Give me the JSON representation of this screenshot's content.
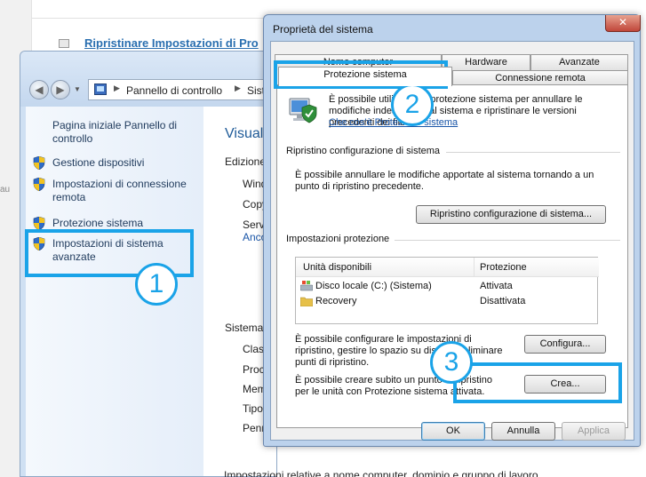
{
  "background_page": {
    "heading_link": "Ripristinare Impostazioni di Pro",
    "left_strip_text": "au"
  },
  "control_panel": {
    "address": {
      "crumb1": "Pannello di controllo",
      "crumb2": "Siste"
    },
    "sidebar": {
      "home": "Pagina iniziale Pannello di controllo",
      "items": [
        {
          "label": "Gestione dispositivi",
          "icon": "uac-shield-icon"
        },
        {
          "label": "Impostazioni di connessione remota",
          "icon": "uac-shield-icon"
        },
        {
          "label": "Protezione sistema",
          "icon": "uac-shield-icon"
        },
        {
          "label": "Impostazioni di sistema avanzate",
          "icon": "uac-shield-icon"
        }
      ]
    },
    "main": {
      "title": "Visuali",
      "edition_label": "Edizione",
      "edition_rows": [
        "Wind",
        "Copy",
        "Servi"
      ],
      "edition_link": "Anco",
      "system_label": "Sistema",
      "system_rows": [
        "Class",
        "Proc",
        "Mem",
        "Tipo",
        "Penn"
      ],
      "footer": "Impostazioni relative a nome computer, dominio e gruppo di lavoro"
    }
  },
  "dialog": {
    "title": "Proprietà del sistema",
    "close_label": "✕",
    "tabs": {
      "computer_name": "Nome computer",
      "hardware": "Hardware",
      "advanced": "Avanzate",
      "system_protection": "Protezione sistema",
      "remote": "Connessione remota"
    },
    "intro_text": "È possibile utilizzare la protezione sistema per annullare le modifiche indesiderate al sistema e ripristinare le versioni precedenti dei file.",
    "intro_link": "Che cos'è Protezione sistema",
    "restore_group": "Ripristino configurazione di sistema",
    "restore_text": "È possibile annullare le modifiche apportate al sistema tornando a un punto di ripristino precedente.",
    "restore_button": "Ripristino configurazione di sistema...",
    "protection_group": "Impostazioni protezione",
    "table": {
      "col_drives": "Unità disponibili",
      "col_protection": "Protezione",
      "rows": [
        {
          "drive": "Disco locale (C:) (Sistema)",
          "protection": "Attivata",
          "icon": "system-drive-icon"
        },
        {
          "drive": "Recovery",
          "protection": "Disattivata",
          "icon": "folder-drive-icon"
        }
      ]
    },
    "configure_text": "È possibile configurare le impostazioni di ripristino, gestire lo spazio su disco ed eliminare punti di ripristino.",
    "configure_button": "Configura...",
    "create_text": "È possibile creare subito un punto di ripristino per le unità con Protezione sistema attivata.",
    "create_button": "Crea...",
    "ok_button": "OK",
    "cancel_button": "Annulla",
    "apply_button": "Applica"
  },
  "annotations": {
    "step1": "1",
    "step2": "2",
    "step3": "3",
    "color": "#1aa3e8"
  }
}
